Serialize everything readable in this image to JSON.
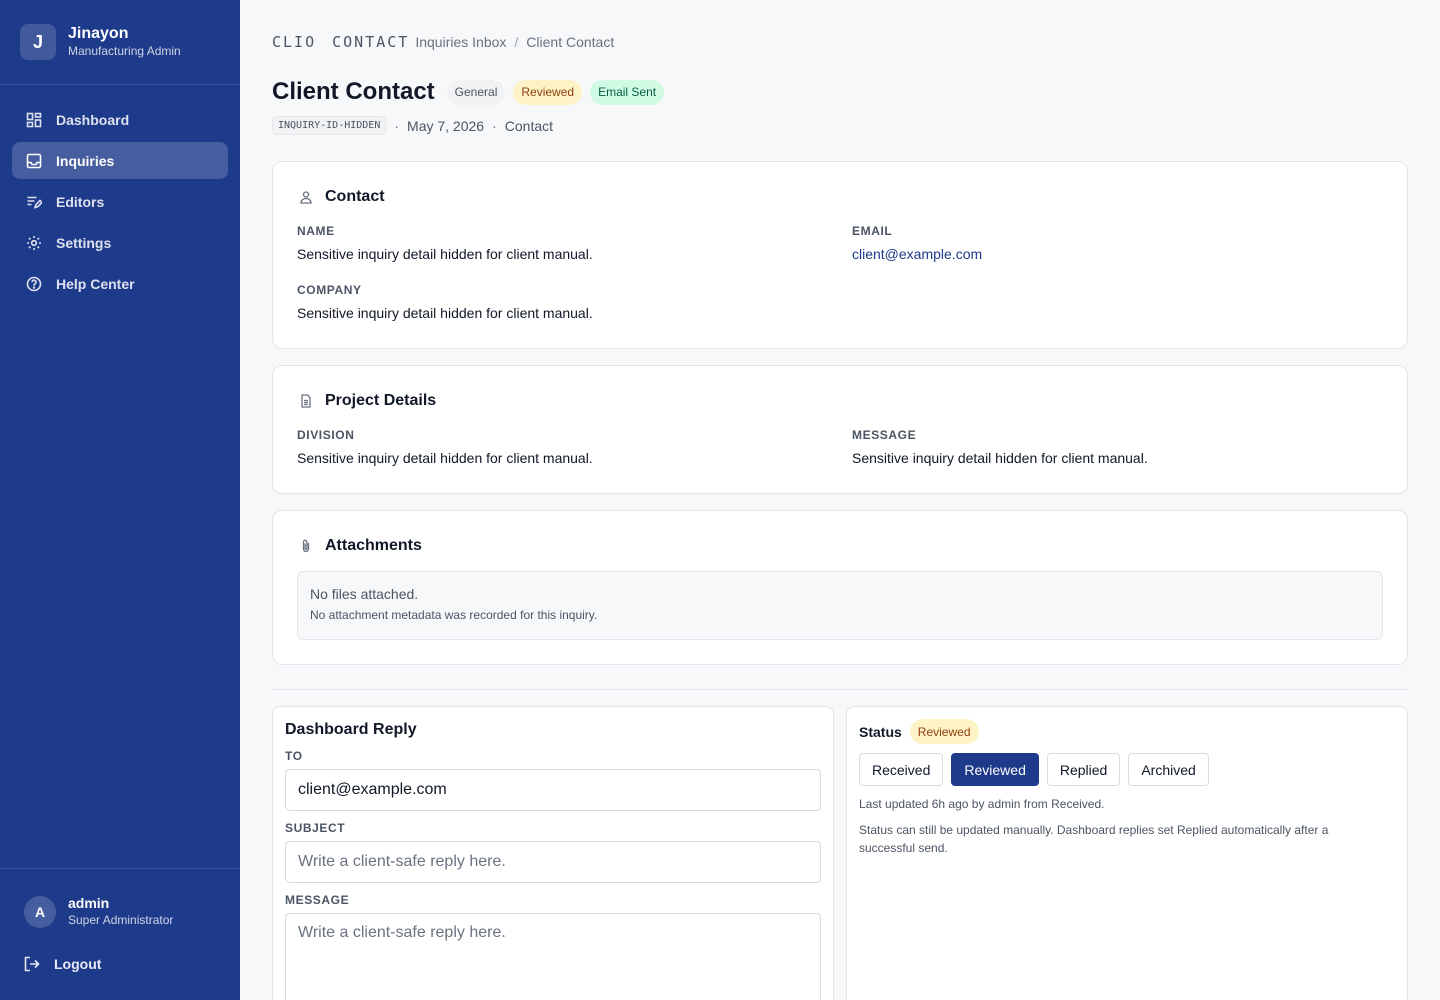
{
  "sidebar": {
    "brand_initial": "J",
    "org_name": "Jinayon",
    "org_role": "Manufacturing Admin",
    "nav": [
      {
        "label": "Dashboard",
        "icon": "dashboard-icon"
      },
      {
        "label": "Inquiries",
        "icon": "inbox-icon",
        "active": true
      },
      {
        "label": "Editors",
        "icon": "editors-icon"
      },
      {
        "label": "Settings",
        "icon": "gear-icon"
      },
      {
        "label": "Help Center",
        "icon": "help-icon"
      }
    ],
    "user_initial": "A",
    "user_name": "admin",
    "user_role": "Super Administrator",
    "logout_label": "Logout"
  },
  "breadcrumb": {
    "logo_part1": "CLIO",
    "logo_part2": "CONTACT",
    "items": [
      "Inquiries Inbox",
      "Client Contact"
    ],
    "separator": "/"
  },
  "header": {
    "title": "Client Contact",
    "badges": [
      "General",
      "Reviewed",
      "Email Sent"
    ],
    "inquiry_id": "INQUIRY-ID-HIDDEN",
    "date": "May 7, 2026",
    "type": "Contact",
    "dot": "·"
  },
  "contact": {
    "heading": "Contact",
    "name_label": "NAME",
    "name_value": "Sensitive inquiry detail hidden for client manual.",
    "email_label": "EMAIL",
    "email_value": "client@example.com",
    "company_label": "COMPANY",
    "company_value": "Sensitive inquiry detail hidden for client manual."
  },
  "project": {
    "heading": "Project Details",
    "division_label": "DIVISION",
    "division_value": "Sensitive inquiry detail hidden for client manual.",
    "message_label": "MESSAGE",
    "message_value": "Sensitive inquiry detail hidden for client manual."
  },
  "attachments": {
    "heading": "Attachments",
    "empty_title": "No files attached.",
    "empty_note": "No attachment metadata was recorded for this inquiry."
  },
  "reply": {
    "heading": "Dashboard Reply",
    "to_label": "TO",
    "to_value": "client@example.com",
    "subject_label": "SUBJECT",
    "subject_placeholder": "Write a client-safe reply here.",
    "message_label": "MESSAGE",
    "message_placeholder": "Write a client-safe reply here."
  },
  "status": {
    "heading": "Status",
    "current": "Reviewed",
    "options": [
      "Received",
      "Reviewed",
      "Replied",
      "Archived"
    ],
    "active_index": 1,
    "last_updated": "Last updated 6h ago by admin from Received.",
    "note": "Status can still be updated manually. Dashboard replies set Replied automatically after a successful send."
  },
  "colors": {
    "sidebar_bg": "#1e3a8a",
    "accent": "#1e3a8a",
    "reviewed_badge_bg": "#fef3c7",
    "email_sent_badge_bg": "#d1fae5"
  }
}
